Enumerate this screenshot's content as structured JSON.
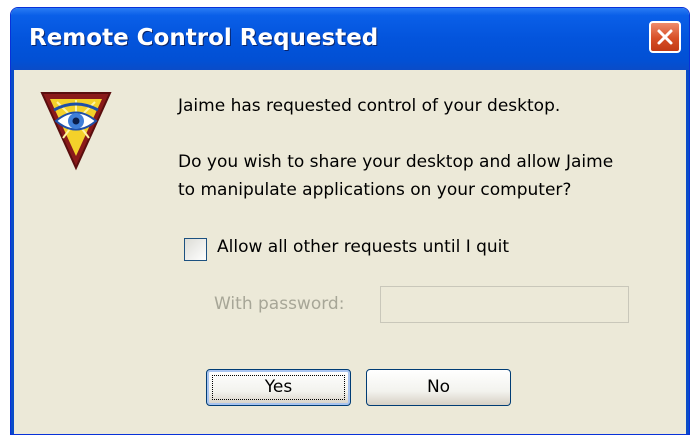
{
  "window": {
    "title": "Remote Control Requested"
  },
  "titlebar": {
    "close_icon": "close-x"
  },
  "app_icon": {
    "name": "eye-triangle-icon"
  },
  "message": {
    "line1": "Jaime has requested control of your desktop.",
    "line2": "Do you wish to share your desktop and allow Jaime",
    "line3": "to manipulate applications on your computer?"
  },
  "options": {
    "allow_all_label": "Allow all other requests until I quit",
    "allow_all_checked": false,
    "password_label": "With password:",
    "password_value": ""
  },
  "buttons": {
    "yes_label": "Yes",
    "no_label": "No"
  },
  "colors": {
    "titlebar": "#0354dc",
    "close_button": "#d74f27",
    "dialog_bg": "#ece9d8",
    "disabled_text": "#a7a697"
  }
}
